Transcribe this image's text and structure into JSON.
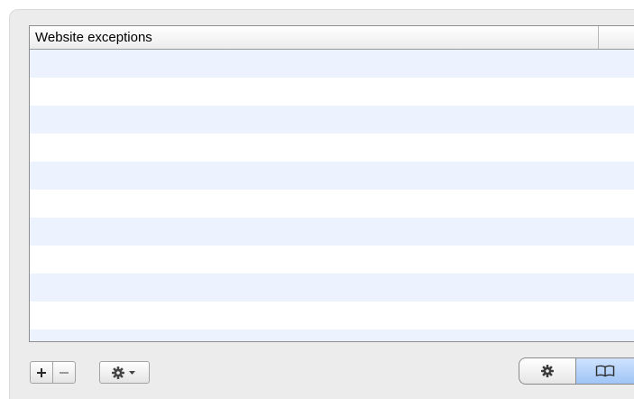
{
  "table": {
    "column_header": "Website exceptions",
    "rows": []
  },
  "toolbar": {
    "add_icon": "plus-icon",
    "remove_icon": "minus-icon",
    "action_icon": "gear-menu-icon"
  },
  "view_switcher": {
    "items": [
      {
        "icon": "gear-icon",
        "selected": false
      },
      {
        "icon": "book-icon",
        "selected": true
      }
    ]
  },
  "colors": {
    "stripe": "#edf3fe",
    "panel": "#ececec",
    "selected_segment": "#b3d1f7"
  }
}
